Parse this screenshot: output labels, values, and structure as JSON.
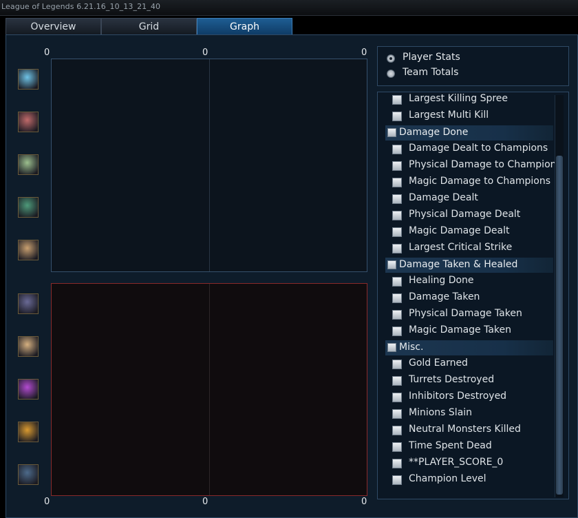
{
  "window": {
    "title": "League of Legends 6.21.16_10_13_21_40"
  },
  "tabs": [
    {
      "label": "Overview",
      "active": false
    },
    {
      "label": "Grid",
      "active": false
    },
    {
      "label": "Graph",
      "active": true
    }
  ],
  "graph": {
    "top_axis": [
      "0",
      "0",
      "0"
    ],
    "bottom_axis": [
      "0",
      "0",
      "0"
    ]
  },
  "team_blue": [
    {
      "icon": "champion-portrait-icon",
      "color": "#6fc3e6"
    },
    {
      "icon": "champion-portrait-icon",
      "color": "#c06a6a"
    },
    {
      "icon": "champion-portrait-icon",
      "color": "#9cbf8e"
    },
    {
      "icon": "champion-portrait-icon",
      "color": "#4e9a7a"
    },
    {
      "icon": "champion-portrait-icon",
      "color": "#c9a070"
    }
  ],
  "team_red": [
    {
      "icon": "champion-portrait-icon",
      "color": "#6a6a96"
    },
    {
      "icon": "champion-portrait-icon",
      "color": "#d5b080"
    },
    {
      "icon": "champion-portrait-icon",
      "color": "#b24bd0"
    },
    {
      "icon": "champion-portrait-icon",
      "color": "#d99a30"
    },
    {
      "icon": "champion-portrait-icon",
      "color": "#4d6a8a"
    }
  ],
  "mode": {
    "options": [
      {
        "label": "Player Stats",
        "selected": true
      },
      {
        "label": "Team Totals",
        "selected": false
      }
    ]
  },
  "stats_list": [
    {
      "type": "item",
      "label": "Largest Killing Spree"
    },
    {
      "type": "item",
      "label": "Largest Multi Kill"
    },
    {
      "type": "category",
      "label": "Damage Done"
    },
    {
      "type": "item",
      "label": "Damage Dealt to Champions"
    },
    {
      "type": "item",
      "label": "Physical Damage to Champions"
    },
    {
      "type": "item",
      "label": "Magic Damage to Champions"
    },
    {
      "type": "item",
      "label": "Damage Dealt"
    },
    {
      "type": "item",
      "label": "Physical Damage Dealt"
    },
    {
      "type": "item",
      "label": "Magic Damage Dealt"
    },
    {
      "type": "item",
      "label": "Largest Critical Strike"
    },
    {
      "type": "category",
      "label": "Damage Taken & Healed"
    },
    {
      "type": "item",
      "label": "Healing Done"
    },
    {
      "type": "item",
      "label": "Damage Taken"
    },
    {
      "type": "item",
      "label": "Physical Damage Taken"
    },
    {
      "type": "item",
      "label": "Magic Damage Taken"
    },
    {
      "type": "category",
      "label": "Misc."
    },
    {
      "type": "item",
      "label": "Gold Earned"
    },
    {
      "type": "item",
      "label": "Turrets Destroyed"
    },
    {
      "type": "item",
      "label": "Inhibitors Destroyed"
    },
    {
      "type": "item",
      "label": "Minions Slain"
    },
    {
      "type": "item",
      "label": "Neutral Monsters Killed"
    },
    {
      "type": "item",
      "label": "Time Spent Dead"
    },
    {
      "type": "item",
      "label": "**PLAYER_SCORE_0"
    },
    {
      "type": "item",
      "label": "Champion Level"
    }
  ]
}
